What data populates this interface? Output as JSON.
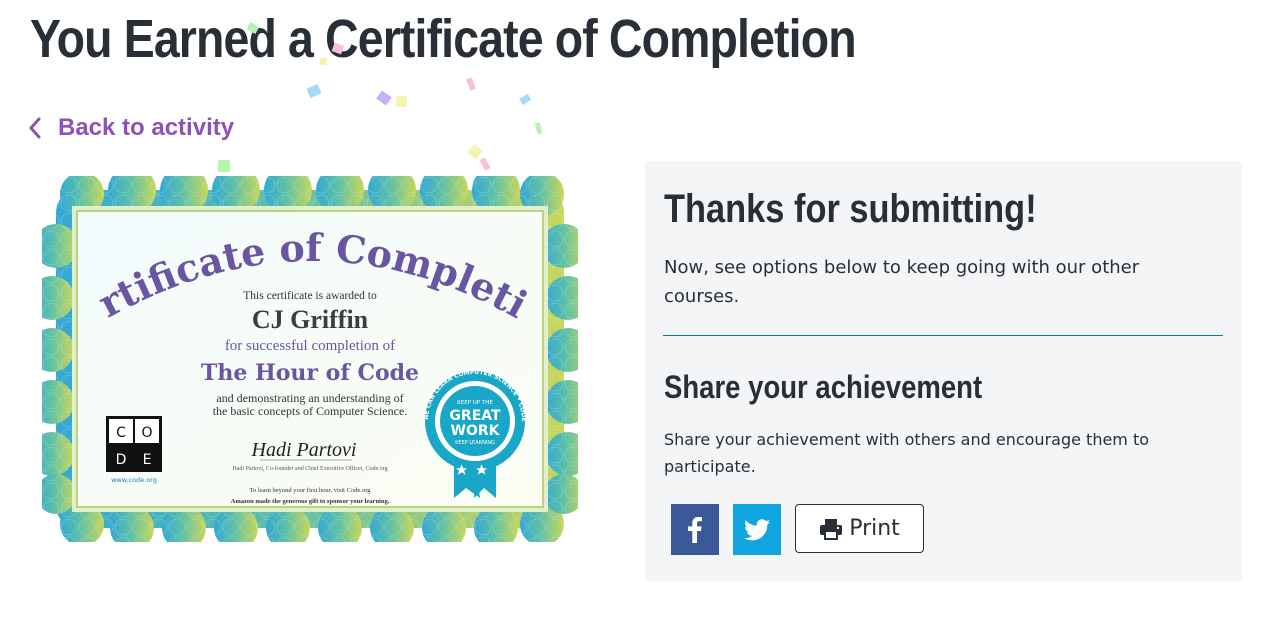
{
  "page": {
    "title": "You Earned a Certificate of Completion"
  },
  "back_link": {
    "label": "Back to activity"
  },
  "certificate": {
    "heading": "Certificate of Completion",
    "awarded_line": "This certificate is awarded to",
    "recipient": "CJ Griffin",
    "completion_line": "for successful completion of",
    "course": "The Hour of Code",
    "demo_line_1": "and demonstrating an understanding of",
    "demo_line_2": "the basic concepts of Computer Science.",
    "signature": "Hadi Partovi",
    "signer_line": "Hadi Partovi, Co-founder and Chief Executive Officer, Code.org",
    "footer_line_1": "To learn beyond your first hour, visit Code.org",
    "footer_line_2": "Amazon made the generous gift to sponsor your learning.",
    "logo_letters": [
      "C",
      "O",
      "D",
      "E"
    ],
    "logo_url": "www.code.org",
    "badge": {
      "line1": "GREAT",
      "line2": "WORK",
      "top_text": "KEEP UP THE",
      "bottom_text": "KEEP LEARNING",
      "ring_text": "ANYONE CAN LEARN COMPUTER SCIENCE • CODE.ORG"
    }
  },
  "panel": {
    "title": "Thanks for submitting!",
    "description": "Now, see options below to keep going with our other courses.",
    "share_title": "Share your achievement",
    "share_description": "Share your achievement with others and encourage them to participate.",
    "print_label": "Print"
  },
  "colors": {
    "title_text": "#292f36",
    "link_purple": "#8c52ba",
    "panel_bg": "#f4f5f7",
    "divider_teal": "#0e7a8a",
    "facebook_blue": "#3b5998",
    "twitter_blue": "#0ea5e0",
    "cert_purple": "#6a55a3",
    "badge_teal": "#1aa6c7"
  },
  "icons": {
    "back": "chevron-left-icon",
    "facebook": "facebook-icon",
    "twitter": "twitter-icon",
    "print": "printer-icon"
  }
}
